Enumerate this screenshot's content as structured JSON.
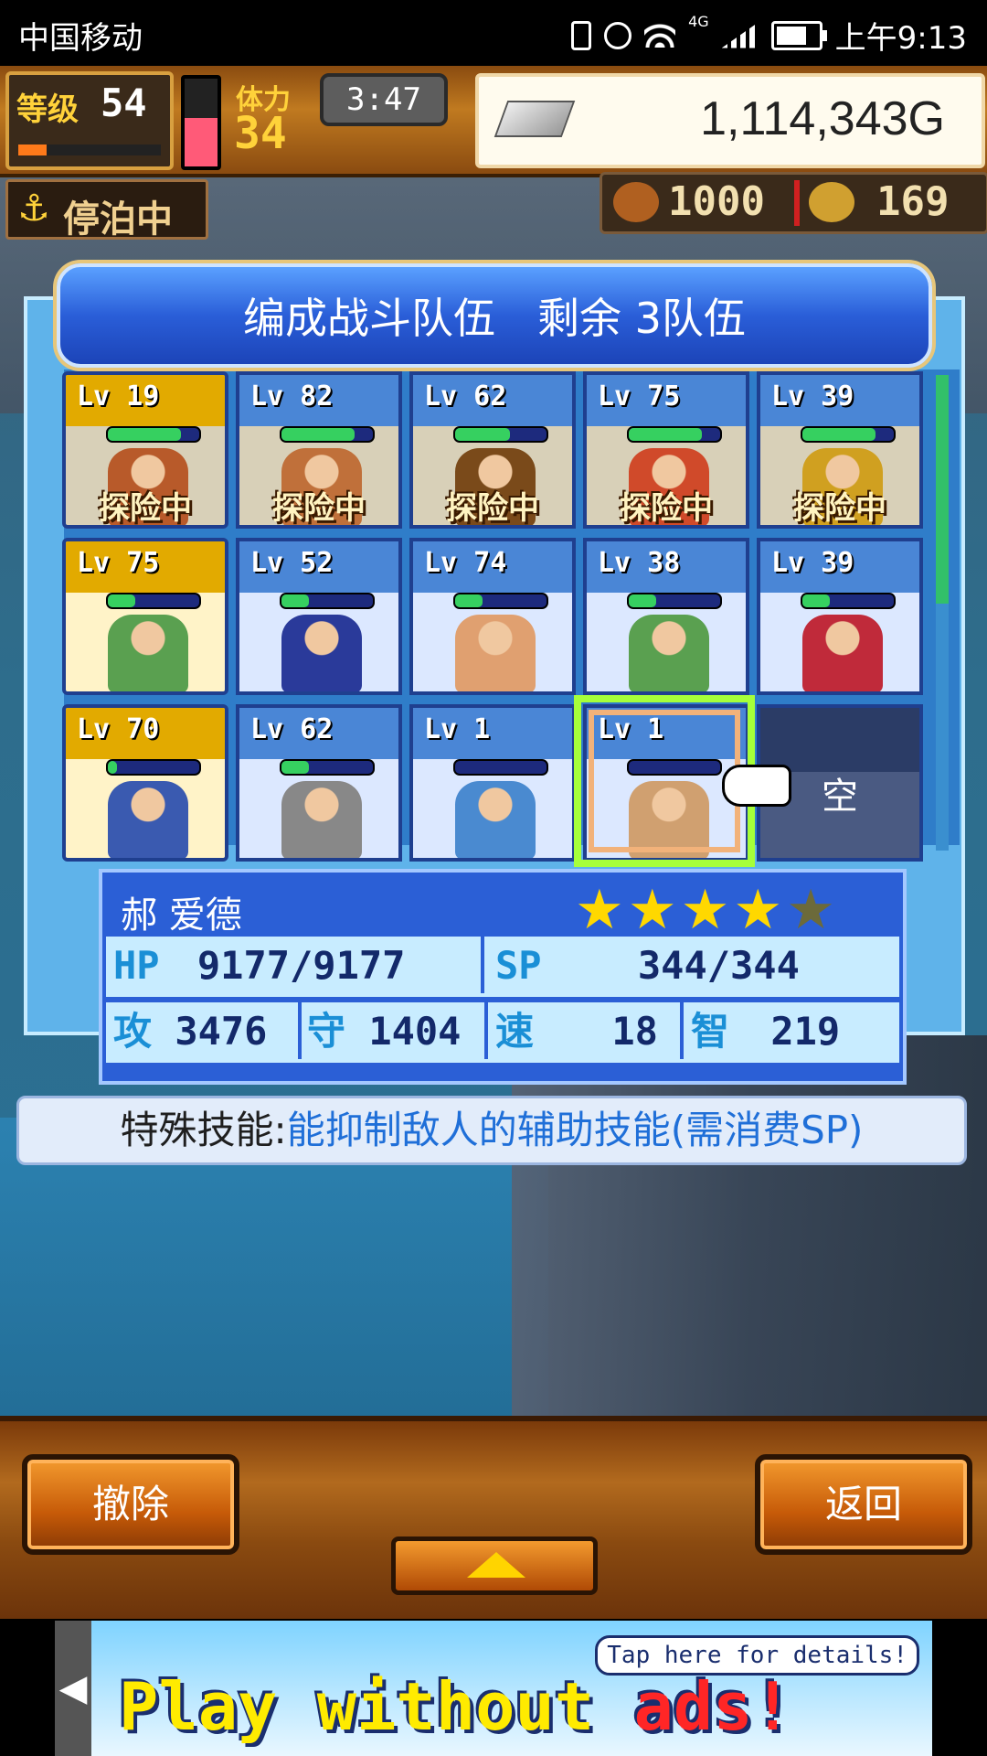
{
  "status_bar": {
    "carrier": "中国移动",
    "network": "4G",
    "time": "上午9:13",
    "icons": [
      "vibrate-icon",
      "alarm-icon",
      "wifi-icon",
      "signal-icon",
      "battery-icon"
    ]
  },
  "hud": {
    "level_label": "等级",
    "level_value": "54",
    "xp_fraction": 0.2,
    "stamina_label": "体力",
    "stamina_value": "34",
    "stamina_fraction": 0.55,
    "timer": "3:47",
    "gold": "1,114,343G",
    "anchor_label": "停泊中",
    "resource_1": "1000",
    "resource_2": "169"
  },
  "panel": {
    "title": "编成战斗队伍　剩余 3队伍"
  },
  "roster": [
    {
      "level": "Lv 19",
      "hp": 0.8,
      "status": "探险中",
      "slot": "busy-gold",
      "sprite": "#b85a2a"
    },
    {
      "level": "Lv 82",
      "hp": 0.8,
      "status": "探险中",
      "slot": "busy",
      "sprite": "#c0703a"
    },
    {
      "level": "Lv 62",
      "hp": 0.6,
      "status": "探险中",
      "slot": "busy",
      "sprite": "#7a4a1a"
    },
    {
      "level": "Lv 75",
      "hp": 0.8,
      "status": "探险中",
      "slot": "busy",
      "sprite": "#d04a2a"
    },
    {
      "level": "Lv 39",
      "hp": 0.8,
      "status": "探险中",
      "slot": "busy",
      "sprite": "#d0a020"
    },
    {
      "level": "Lv 75",
      "hp": 0.3,
      "status": "",
      "slot": "gold",
      "sprite": "#5aa050"
    },
    {
      "level": "Lv 52",
      "hp": 0.3,
      "status": "",
      "slot": "normal",
      "sprite": "#2a3a9a"
    },
    {
      "level": "Lv 74",
      "hp": 0.3,
      "status": "",
      "slot": "normal",
      "sprite": "#e0a070"
    },
    {
      "level": "Lv 38",
      "hp": 0.3,
      "status": "",
      "slot": "normal",
      "sprite": "#5aa050"
    },
    {
      "level": "Lv 39",
      "hp": 0.3,
      "status": "",
      "slot": "normal",
      "sprite": "#c02a3a"
    },
    {
      "level": "Lv 70",
      "hp": 0.1,
      "status": "",
      "slot": "gold",
      "sprite": "#3a5ab0"
    },
    {
      "level": "Lv 62",
      "hp": 0.3,
      "status": "",
      "slot": "normal",
      "sprite": "#888888"
    },
    {
      "level": "Lv 1",
      "hp": 0.0,
      "status": "",
      "slot": "normal",
      "sprite": "#4a8ad0"
    },
    {
      "level": "Lv 1",
      "hp": 0.0,
      "status": "",
      "slot": "normal",
      "sprite": "#d0a070"
    }
  ],
  "empty_slot_label": "空",
  "selected": {
    "name": "郝 爱德",
    "stars": 4,
    "stars_max": 5,
    "hp_label": "HP",
    "hp_value": "9177/9177",
    "sp_label": "SP",
    "sp_value": "344/344",
    "atk_label": "攻",
    "atk_value": "3476",
    "def_label": "守",
    "def_value": "1404",
    "spd_label": "速",
    "spd_value": "18",
    "int_label": "智",
    "int_value": "219"
  },
  "skill": {
    "label": "特殊技能:",
    "value": "能抑制敌人的辅助技能(需消费SP)"
  },
  "buttons": {
    "remove": "撤除",
    "back": "返回"
  },
  "ad": {
    "text_main": "Play without ",
    "text_accent": "ads!",
    "tap": "Tap here for details!"
  },
  "colors": {
    "panel_blue": "#2f7dc9",
    "hp_green": "#36d060",
    "gold_yellow": "#ffd800",
    "skill_blue": "#1f6fd8",
    "select_green": "#a6ff3a"
  }
}
